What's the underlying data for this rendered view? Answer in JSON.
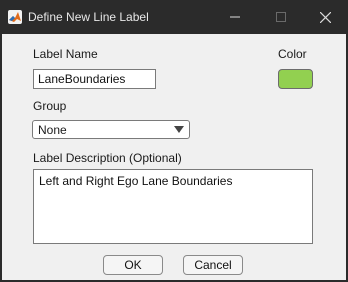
{
  "window": {
    "title": "Define New Line Label",
    "app_icon": "matlab-logo-icon",
    "controls": {
      "minimize": "minimize-icon",
      "maximize": "maximize-icon",
      "close": "close-icon"
    }
  },
  "form": {
    "label_name_label": "Label Name",
    "label_name_value": "LaneBoundaries",
    "color_label": "Color",
    "color_value": "#92d050",
    "group_label": "Group",
    "group_selected": "None",
    "description_label": "Label Description (Optional)",
    "description_value": "Left and Right Ego Lane Boundaries"
  },
  "buttons": {
    "ok": "OK",
    "cancel": "Cancel"
  }
}
